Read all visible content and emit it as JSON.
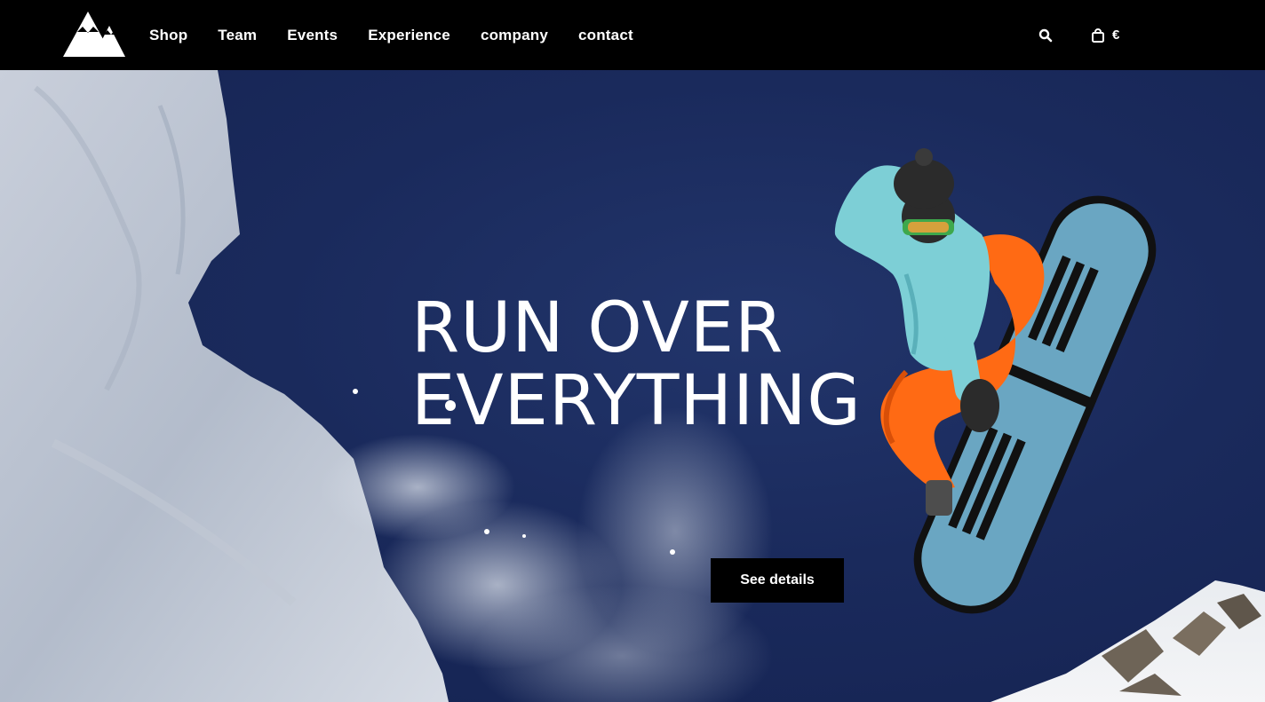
{
  "header": {
    "logo_icon": "mountain-logo-icon",
    "nav": [
      {
        "label": "Shop"
      },
      {
        "label": "Team"
      },
      {
        "label": "Events"
      },
      {
        "label": "Experience"
      },
      {
        "label": "company"
      },
      {
        "label": "contact"
      }
    ],
    "search_icon": "search-icon",
    "cart_icon": "shopping-bag-icon",
    "currency": "€"
  },
  "hero": {
    "headline_line1": "RUN OVER",
    "headline_line2": "EVERYTHING",
    "cta_label": "See details"
  },
  "colors": {
    "header_bg": "#000000",
    "sky": "#1c2c5e",
    "text": "#ffffff",
    "cta_bg": "#000000",
    "jacket": "#7dcfd6",
    "pants": "#ff6a14",
    "board": "#6aa6c2"
  }
}
